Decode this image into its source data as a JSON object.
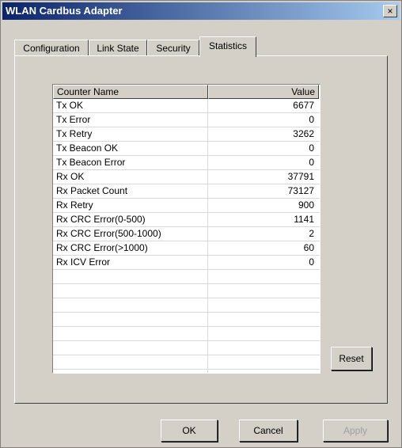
{
  "window": {
    "title": "WLAN Cardbus Adapter",
    "close_label": "×"
  },
  "tabs": [
    {
      "label": "Configuration",
      "active": false
    },
    {
      "label": "Link State",
      "active": false
    },
    {
      "label": "Security",
      "active": false
    },
    {
      "label": "Statistics",
      "active": true
    }
  ],
  "table": {
    "columns": [
      "Counter Name",
      "Value"
    ],
    "rows": [
      {
        "name": "Tx OK",
        "value": "6677"
      },
      {
        "name": "Tx Error",
        "value": "0"
      },
      {
        "name": "Tx Retry",
        "value": "3262"
      },
      {
        "name": "Tx Beacon OK",
        "value": "0"
      },
      {
        "name": "Tx Beacon Error",
        "value": "0"
      },
      {
        "name": "Rx OK",
        "value": "37791"
      },
      {
        "name": "Rx Packet Count",
        "value": "73127"
      },
      {
        "name": "Rx Retry",
        "value": "900"
      },
      {
        "name": "Rx CRC Error(0-500)",
        "value": "1141"
      },
      {
        "name": "Rx CRC Error(500-1000)",
        "value": "2"
      },
      {
        "name": "Rx CRC Error(>1000)",
        "value": "60"
      },
      {
        "name": "Rx ICV Error",
        "value": "0"
      },
      {
        "name": "",
        "value": ""
      },
      {
        "name": "",
        "value": ""
      },
      {
        "name": "",
        "value": ""
      },
      {
        "name": "",
        "value": ""
      },
      {
        "name": "",
        "value": ""
      },
      {
        "name": "",
        "value": ""
      },
      {
        "name": "",
        "value": ""
      },
      {
        "name": "",
        "value": ""
      }
    ]
  },
  "buttons": {
    "reset": "Reset",
    "ok": "OK",
    "cancel": "Cancel",
    "apply": "Apply"
  }
}
